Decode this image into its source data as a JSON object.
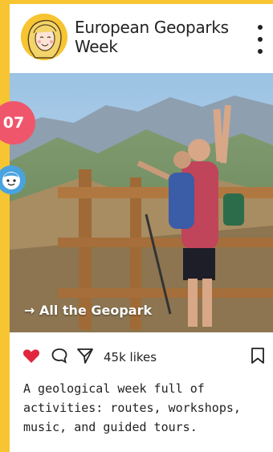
{
  "post": {
    "title": "European Geoparks Week",
    "badge_number": "07",
    "photo_link": "→ All the Geopark",
    "likes": "45k likes",
    "caption": "A geological week full of activities: routes, workshops, music, and guided tours."
  },
  "icons": {
    "menu": "more-vertical-icon",
    "like": "heart-icon",
    "comment": "comment-bubble-icon",
    "share": "send-icon",
    "save": "bookmark-icon",
    "badge_face": "smiley-face-icon"
  },
  "colors": {
    "background": "#f7c531",
    "badge": "#f0566b",
    "like": "#e0263f",
    "face_badge": "#4aa3df"
  }
}
